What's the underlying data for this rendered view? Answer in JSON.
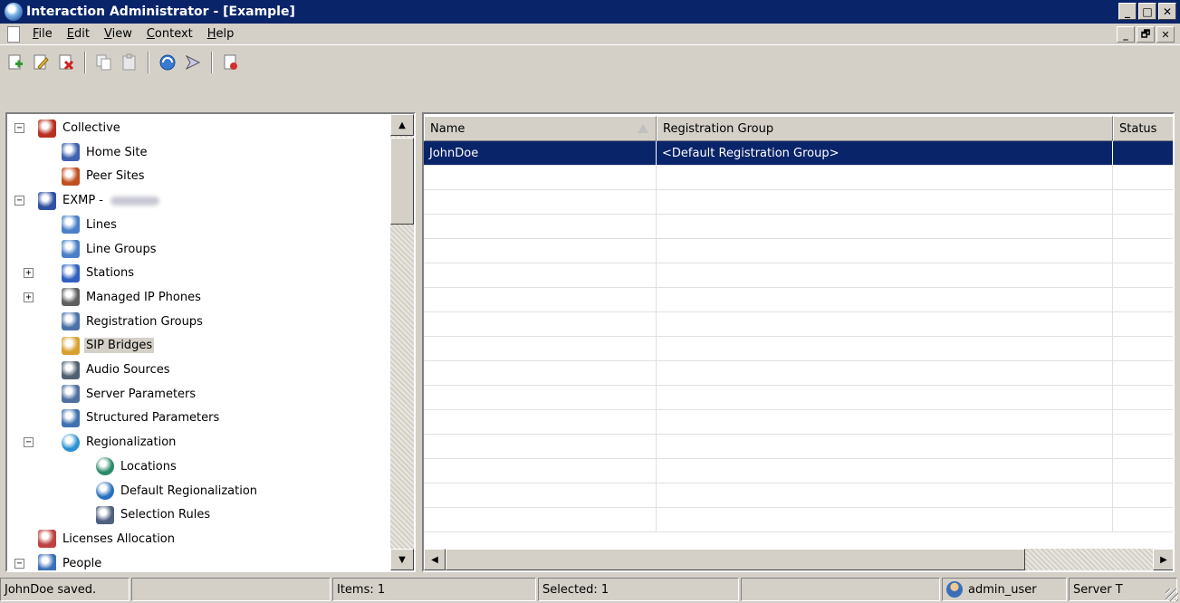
{
  "window": {
    "title": "Interaction Administrator - [Example]",
    "controls": [
      "_",
      "□",
      "✕"
    ],
    "mdi_controls": [
      "_",
      "🗗",
      "✕"
    ]
  },
  "menu": {
    "items": [
      {
        "label": "File",
        "accel": "F",
        "rest": "ile"
      },
      {
        "label": "Edit",
        "accel": "E",
        "rest": "dit"
      },
      {
        "label": "View",
        "accel": "V",
        "rest": "iew"
      },
      {
        "label": "Context",
        "accel": "C",
        "rest": "ontext"
      },
      {
        "label": "Help",
        "accel": "H",
        "rest": "elp"
      }
    ]
  },
  "toolbar": {
    "buttons": [
      "new-icon",
      "edit-icon",
      "delete-icon",
      "copy-icon",
      "paste-icon",
      "refresh-icon",
      "connect-icon",
      "properties-icon"
    ]
  },
  "tree": {
    "nodes": [
      {
        "label": "Collective",
        "level": 0,
        "expander": "−",
        "icon": "collective-icon"
      },
      {
        "label": "Home Site",
        "level": 1,
        "expander": "",
        "icon": "home-site-icon"
      },
      {
        "label": "Peer Sites",
        "level": 1,
        "expander": "",
        "icon": "peer-sites-icon"
      },
      {
        "label": "EXMP -",
        "level": 0,
        "expander": "−",
        "icon": "server-icon",
        "blurred": true
      },
      {
        "label": "Lines",
        "level": 1,
        "expander": "",
        "icon": "lines-icon"
      },
      {
        "label": "Line Groups",
        "level": 1,
        "expander": "",
        "icon": "line-groups-icon"
      },
      {
        "label": "Stations",
        "level": 1,
        "expander": "+",
        "icon": "stations-icon"
      },
      {
        "label": "Managed IP Phones",
        "level": 1,
        "expander": "+",
        "icon": "phones-icon"
      },
      {
        "label": "Registration Groups",
        "level": 1,
        "expander": "",
        "icon": "registration-groups-icon"
      },
      {
        "label": "SIP Bridges",
        "level": 1,
        "expander": "",
        "icon": "sip-bridges-icon",
        "selected": true
      },
      {
        "label": "Audio Sources",
        "level": 1,
        "expander": "",
        "icon": "audio-sources-icon"
      },
      {
        "label": "Server Parameters",
        "level": 1,
        "expander": "",
        "icon": "server-parameters-icon"
      },
      {
        "label": "Structured Parameters",
        "level": 1,
        "expander": "",
        "icon": "structured-parameters-icon"
      },
      {
        "label": "Regionalization",
        "level": 1,
        "expander": "−",
        "icon": "globe-icon"
      },
      {
        "label": "Locations",
        "level": 2,
        "expander": "",
        "icon": "locations-icon"
      },
      {
        "label": "Default Regionalization",
        "level": 2,
        "expander": "",
        "icon": "default-regionalization-icon"
      },
      {
        "label": "Selection Rules",
        "level": 2,
        "expander": "",
        "icon": "selection-rules-icon"
      },
      {
        "label": "Licenses Allocation",
        "level": 0,
        "expander": "",
        "icon": "licenses-icon"
      },
      {
        "label": "People",
        "level": 0,
        "expander": "−",
        "icon": "people-icon"
      }
    ]
  },
  "list": {
    "columns": [
      "Name",
      "Registration Group",
      "Status"
    ],
    "rows": [
      {
        "name": "JohnDoe",
        "registration_group": "<Default Registration Group>",
        "status": "",
        "selected": true
      }
    ],
    "empty_rows": 15
  },
  "statusbar": {
    "message": "JohnDoe saved.",
    "items": "Items: 1",
    "selected": "Selected: 1",
    "user": "admin_user",
    "server": "Server T"
  }
}
